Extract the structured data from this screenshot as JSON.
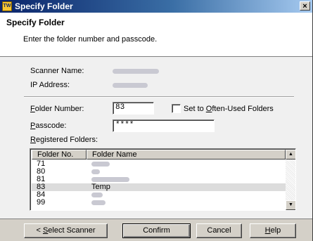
{
  "window": {
    "title": "Specify Folder",
    "app_icon": "scanner-app-icon",
    "close_glyph": "×"
  },
  "header": {
    "title": "Specify Folder",
    "subtitle": "Enter the folder number and passcode."
  },
  "fields": {
    "scanner_name_label": "Scanner Name:",
    "ip_address_label": "IP Address:",
    "folder_number_label_u": "F",
    "folder_number_label_rest": "older Number:",
    "folder_number_value": "83",
    "often_used_label_pre": "Set to ",
    "often_used_label_u": "O",
    "often_used_label_rest": "ften-Used Folders",
    "passcode_label_u": "P",
    "passcode_label_rest": "asscode:",
    "passcode_value": "****",
    "registered_label_u": "R",
    "registered_label_rest": "egistered Folders:"
  },
  "table": {
    "columns": [
      "Folder No.",
      "Folder Name"
    ],
    "rows": [
      {
        "no": "71",
        "name": ""
      },
      {
        "no": "80",
        "name": ""
      },
      {
        "no": "81",
        "name": ""
      },
      {
        "no": "83",
        "name": "Temp"
      },
      {
        "no": "84",
        "name": ""
      },
      {
        "no": "99",
        "name": ""
      }
    ],
    "selected_row": "83"
  },
  "scrollbar": {
    "up_glyph": "▲",
    "down_glyph": "▼"
  },
  "buttons": {
    "back_pre": "< ",
    "back_u": "S",
    "back_rest": "elect Scanner",
    "confirm": "Confirm",
    "cancel": "Cancel",
    "help_u": "H",
    "help_rest": "elp"
  }
}
